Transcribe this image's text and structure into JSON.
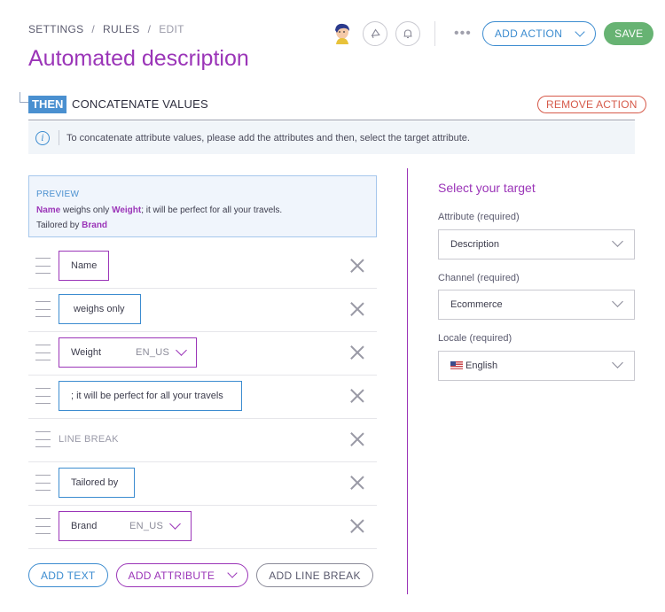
{
  "breadcrumb": {
    "settings": "SETTINGS",
    "rules": "RULES",
    "edit": "EDIT",
    "separator": "/"
  },
  "page_title": "Automated description",
  "header": {
    "more_icon": "•••",
    "add_action_label": "ADD ACTION",
    "save_label": "SAVE"
  },
  "section": {
    "badge": "THEN",
    "title": "CONCATENATE VALUES",
    "remove_label": "REMOVE ACTION"
  },
  "info": {
    "icon": "i",
    "text": "To concatenate attribute values, please add the attributes and then, select the target attribute."
  },
  "preview": {
    "title": "PREVIEW",
    "line1": [
      {
        "text": "Name",
        "highlight": true
      },
      {
        "text": " weighs only ",
        "highlight": false
      },
      {
        "text": "Weight",
        "highlight": true
      },
      {
        "text": "; it will be perfect for all your travels.",
        "highlight": false
      }
    ],
    "line2": [
      {
        "text": "Tailored by ",
        "highlight": false
      },
      {
        "text": "Brand",
        "highlight": true
      }
    ]
  },
  "rows": [
    {
      "type": "attribute",
      "label": "Name",
      "locale": ""
    },
    {
      "type": "text",
      "label": " weighs only"
    },
    {
      "type": "attribute",
      "label": "Weight",
      "locale": "EN_US"
    },
    {
      "type": "text",
      "label": "; it will be perfect for all your travels"
    },
    {
      "type": "linebreak",
      "label": "LINE BREAK"
    },
    {
      "type": "text",
      "label": "Tailored by"
    },
    {
      "type": "attribute",
      "label": "Brand",
      "locale": "EN_US"
    }
  ],
  "buttons": {
    "add_text": "ADD TEXT",
    "add_attribute": "ADD ATTRIBUTE",
    "add_line_break": "ADD LINE BREAK"
  },
  "target": {
    "title": "Select your target",
    "attribute_label": "Attribute (required)",
    "attribute_value": "Description",
    "channel_label": "Channel (required)",
    "channel_value": "Ecommerce",
    "locale_label": "Locale (required)",
    "locale_value": "English"
  },
  "colors": {
    "purple": "#9b35b8",
    "blue": "#3c8cd0",
    "green": "#67b373",
    "red": "#d65a4a"
  }
}
